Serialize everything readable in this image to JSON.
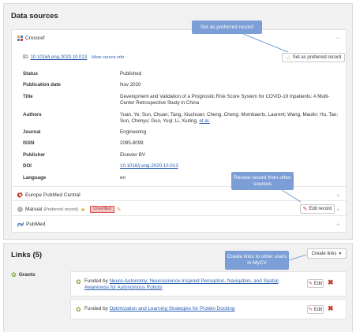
{
  "data_sources": {
    "title": "Data sources",
    "crossref": {
      "name": "Crossref",
      "collapse_glyph": "−",
      "id_label": "ID:",
      "id_value": "10.1016/j.eng.2020.10.013",
      "more_info": "More source info",
      "preferred_button": "Set as preferred record",
      "fields": [
        {
          "label": "Status",
          "value": "Published"
        },
        {
          "label": "Publication date",
          "value": "Nov 2020"
        },
        {
          "label": "Title",
          "value": "Development and Validation of a Prognostic Risk Score System for COVID-19 Inpatients: A Multi-Center Retrospective Study in China"
        },
        {
          "label": "Authors",
          "value": "Yuan, Ye; Sun, Chuan; Tang, Xiuchuan; Cheng, Cheng; Mombaerts, Laurent; Wang, Maolin; Hu, Tao; Sun, Chenyu; Guo, Yuqi; Li, Xiuting,",
          "value_link": "et al."
        },
        {
          "label": "Journal",
          "value": "Engineering"
        },
        {
          "label": "ISSN",
          "value": "2095-8099"
        },
        {
          "label": "Publisher",
          "value": "Elsevier BV"
        },
        {
          "label": "DOI",
          "value": "10.1016/j.eng.2020.10.013"
        },
        {
          "label": "Language",
          "value": "en"
        }
      ]
    },
    "europe_pmc": {
      "name": "Europe PubMed Central",
      "glyph": "+"
    },
    "manual": {
      "name": "Manual",
      "note": "(Preferred record)",
      "badge": "Unverified",
      "edit_button": "Edit record",
      "glyph": "+"
    },
    "pubmed": {
      "name": "PubMed",
      "glyph": "+"
    }
  },
  "callouts": {
    "preferred": "Set as preferred record",
    "review": "Review record from other sources",
    "create_links": "Create links to other users in MyCV"
  },
  "links": {
    "title": "Links (5)",
    "create_button": "Create links",
    "grants_label": "Grants",
    "items": [
      {
        "prefix": "Funded by",
        "link": "Neuro-Autonomy: Neuroscience-Inspired Perception, Navigation, and Spatial Awareness for Autonomous Robots",
        "edit": "Edit"
      },
      {
        "prefix": "Funded by",
        "link": "Optimization and Learning Strategies for Protein Docking",
        "edit": "Edit"
      }
    ]
  },
  "colors": {
    "callout": "#7b9ed6",
    "link": "#2a5db0",
    "badge_bg": "#f2c4c4",
    "badge_border": "#d9534f",
    "delete": "#c0392b",
    "star": "#e0a030",
    "grant_icon": "#7aa52e"
  },
  "icons": {
    "crossref": "crossref-logo-icon",
    "europe_pmc": "europe-pmc-logo-icon",
    "manual": "person-circle-icon",
    "pubmed": "pubmed-logo-icon",
    "star": "star-icon",
    "pencil": "pencil-icon",
    "grant": "grant-award-icon",
    "delete": "x-icon",
    "caret": "caret-down-icon"
  }
}
